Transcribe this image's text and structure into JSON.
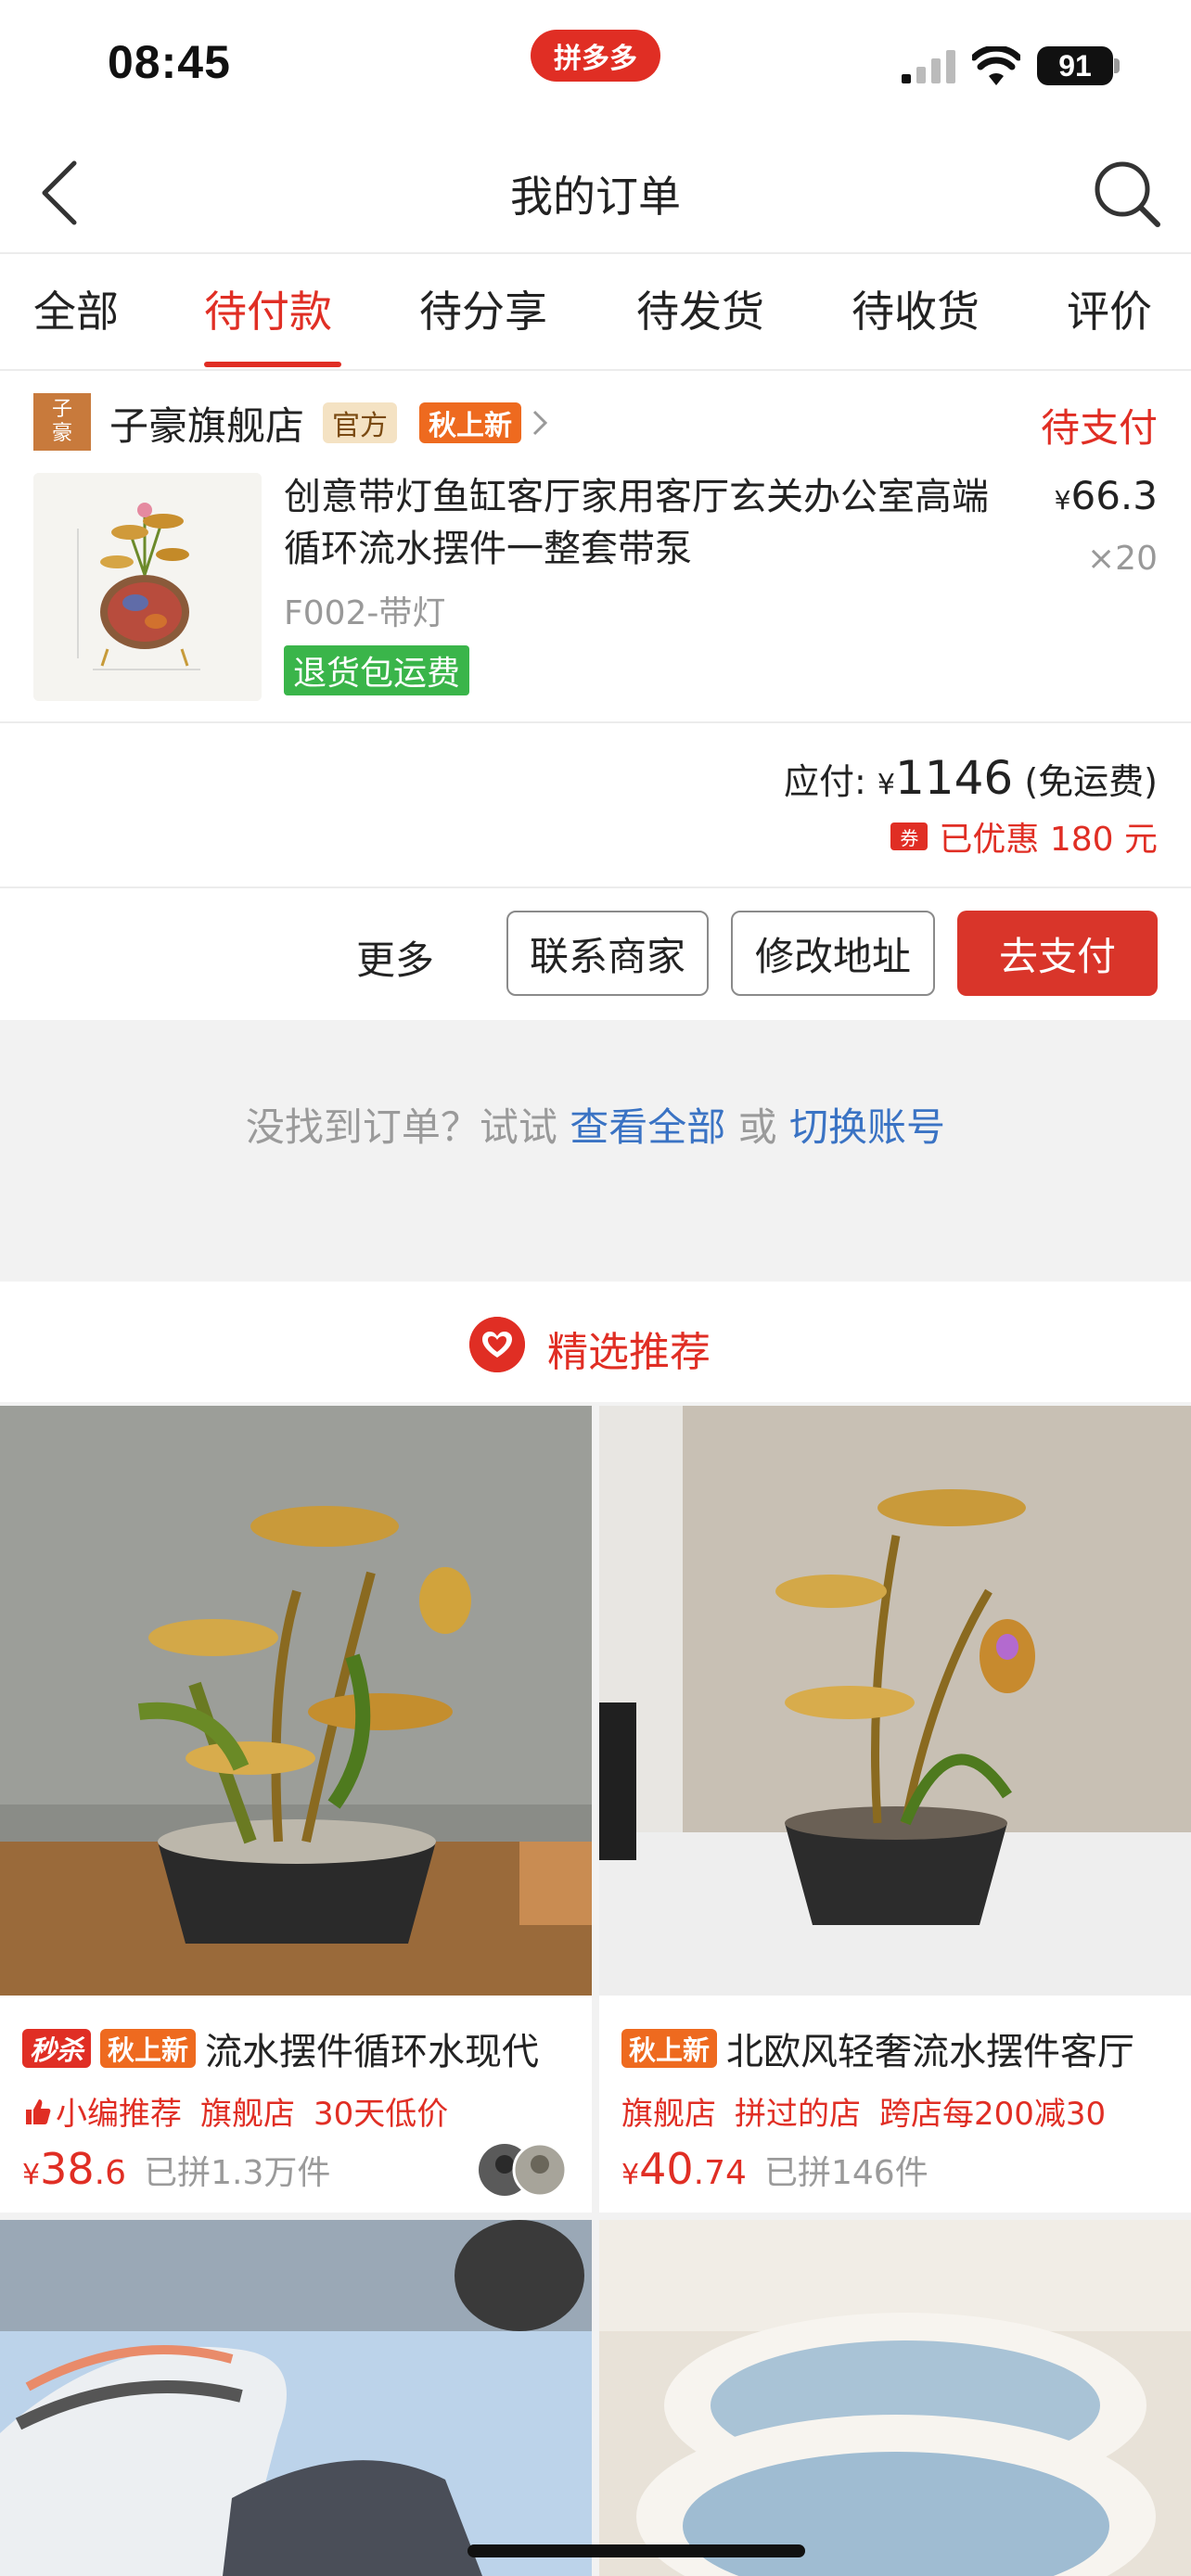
{
  "status_bar": {
    "time": "08:45",
    "app_badge": "拼多多",
    "battery": "91"
  },
  "nav": {
    "title": "我的订单",
    "back_icon": "chevron-left-icon",
    "search_icon": "search-icon"
  },
  "tabs": [
    {
      "label": "全部",
      "active": false
    },
    {
      "label": "待付款",
      "active": true
    },
    {
      "label": "待分享",
      "active": false
    },
    {
      "label": "待发货",
      "active": false
    },
    {
      "label": "待收货",
      "active": false
    },
    {
      "label": "评价",
      "active": false
    }
  ],
  "order": {
    "shop": {
      "logo_text_1": "子",
      "logo_text_2": "豪",
      "name": "子豪旗舰店",
      "tag_official": "官方",
      "tag_new": "秋上新"
    },
    "status": "待支付",
    "product": {
      "title": "创意带灯鱼缸客厅家用客厅玄关办公室高端循环流水摆件一整套带泵",
      "price_symbol": "¥",
      "price": "66.3",
      "quantity": "×20",
      "spec": "F002-带灯",
      "return_tag": "退货包运费"
    },
    "total": {
      "label": "应付:",
      "symbol": "¥",
      "amount": "1146",
      "shipping": "(免运费)"
    },
    "discount": {
      "coupon_icon": "券",
      "text": "已优惠 180 元"
    },
    "actions": {
      "more": "更多",
      "contact": "联系商家",
      "address": "修改地址",
      "pay": "去支付"
    }
  },
  "hint": {
    "prefix": "没找到订单？试试",
    "link_all": "查看全部",
    "middle": "或",
    "link_switch": "切换账号"
  },
  "recommend": {
    "title": "精选推荐",
    "icon": "heart-icon"
  },
  "products": [
    {
      "badges": [
        "秒杀",
        "秋上新"
      ],
      "title": "流水摆件循环水现代",
      "tags": [
        "小编推荐",
        "旗舰店",
        "30天低价"
      ],
      "tag_icon": "thumbs-up-icon",
      "price_symbol": "¥",
      "price_int": "38",
      "price_dec": ".6",
      "sold": "已拼1.3万件"
    },
    {
      "badges": [
        "秋上新"
      ],
      "title": "北欧风轻奢流水摆件客厅",
      "tags": [
        "旗舰店",
        "拼过的店",
        "跨店每200减30"
      ],
      "price_symbol": "¥",
      "price_int": "40",
      "price_dec": ".74",
      "sold": "已拼146件"
    }
  ],
  "colors": {
    "accent": "#e02e24",
    "link": "#3a73c4",
    "return_green": "#3ab54a",
    "new_orange": "#ee6a1f"
  }
}
